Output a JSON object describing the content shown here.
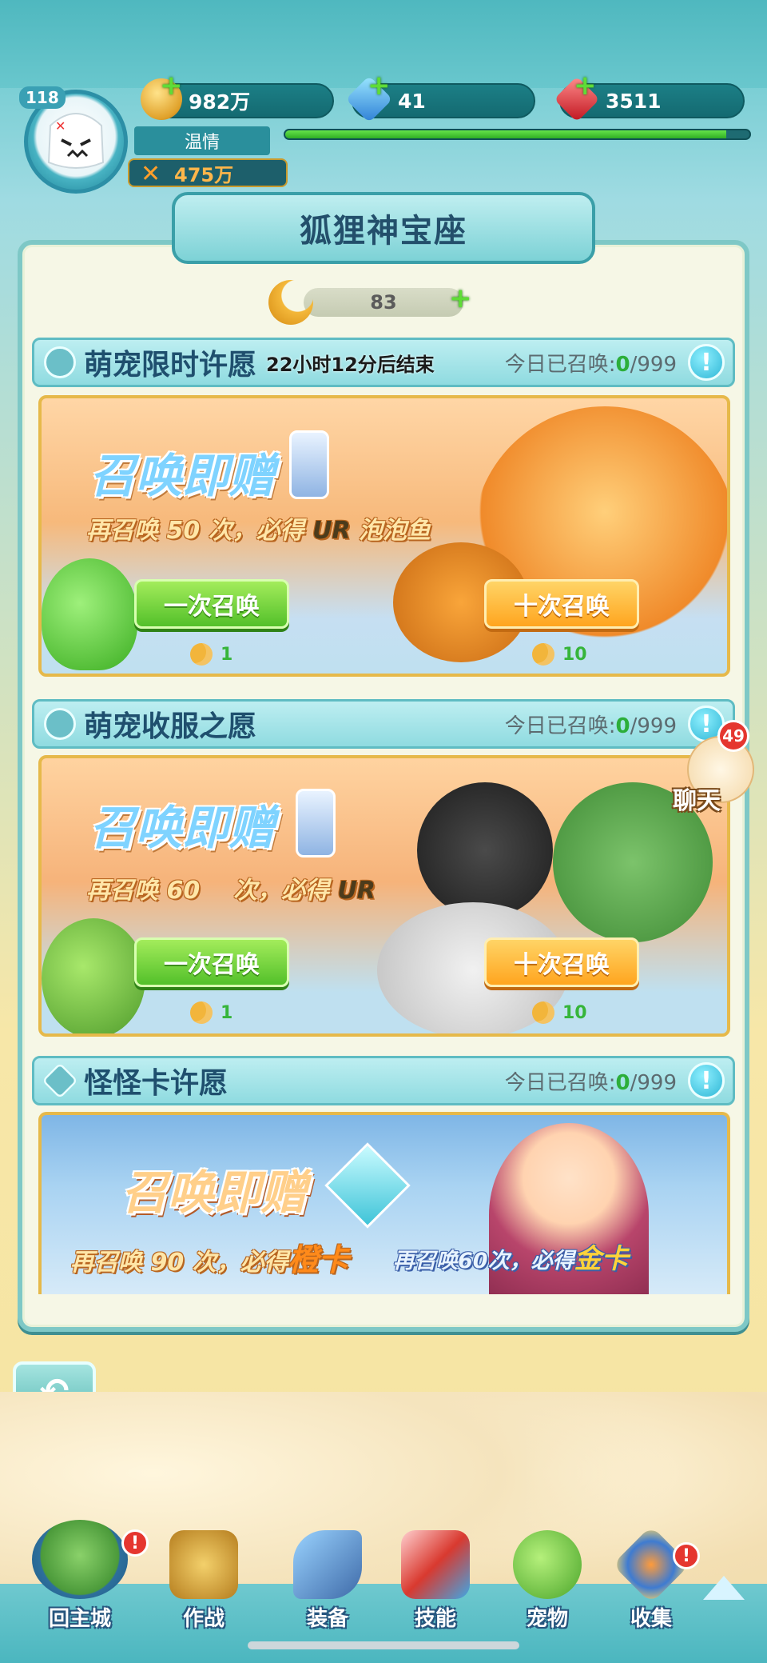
{
  "player": {
    "level": "118",
    "name": "温情",
    "power": "475万",
    "gold": "982万",
    "diamond": "41",
    "ruby": "3511",
    "exp_fraction": 0.95
  },
  "panel": {
    "title": "狐狸神宝座",
    "moon_count": "83"
  },
  "sections": [
    {
      "title": "萌宠限时许愿",
      "timer": "22小时12分后结束",
      "count_label": "今日已召唤:",
      "count_value": "0",
      "count_max": "/999",
      "info": "!",
      "promo_title": "召唤即赠",
      "promo_sub_a": "再召唤 50 次，必得",
      "promo_sub_rank": "UR",
      "promo_sub_b": "泡泡鱼",
      "btn_single": "一次召唤",
      "btn_ten": "十次召唤",
      "cost_single": "1",
      "cost_ten": "10"
    },
    {
      "title": "萌宠收服之愿",
      "count_label": "今日已召唤:",
      "count_value": "0",
      "count_max": "/999",
      "info": "!",
      "promo_title": "召唤即赠",
      "promo_sub_a": "再召唤 60",
      "promo_sub_b": "次，必得",
      "promo_sub_rank": "UR",
      "btn_single": "一次召唤",
      "btn_ten": "十次召唤",
      "cost_single": "1",
      "cost_ten": "10"
    },
    {
      "title": "怪怪卡许愿",
      "count_label": "今日已召唤:",
      "count_value": "0",
      "count_max": "/999",
      "info": "!",
      "promo_title": "召唤即赠",
      "promo_sub_a": "再召唤 90 次，必得",
      "promo_sub_card": "橙卡",
      "promo_sub_c": "再召唤60次，必得",
      "promo_sub_card2": "金卡"
    }
  ],
  "chat": {
    "label": "聊天",
    "badge": "49"
  },
  "nav": [
    {
      "label": "回主城",
      "icon": "castle-island-icon",
      "badge": "!"
    },
    {
      "label": "作战",
      "icon": "totem-battle-icon"
    },
    {
      "label": "装备",
      "icon": "cannon-equip-icon"
    },
    {
      "label": "技能",
      "icon": "spellbook-skill-icon"
    },
    {
      "label": "宠物",
      "icon": "slime-pet-icon"
    },
    {
      "label": "收集",
      "icon": "collection-emblem-icon",
      "badge": "!"
    }
  ],
  "colors": {
    "accent": "#7ec8c6",
    "green": "#53c02a",
    "orange": "#ffa51f",
    "badge": "#e5362f"
  }
}
